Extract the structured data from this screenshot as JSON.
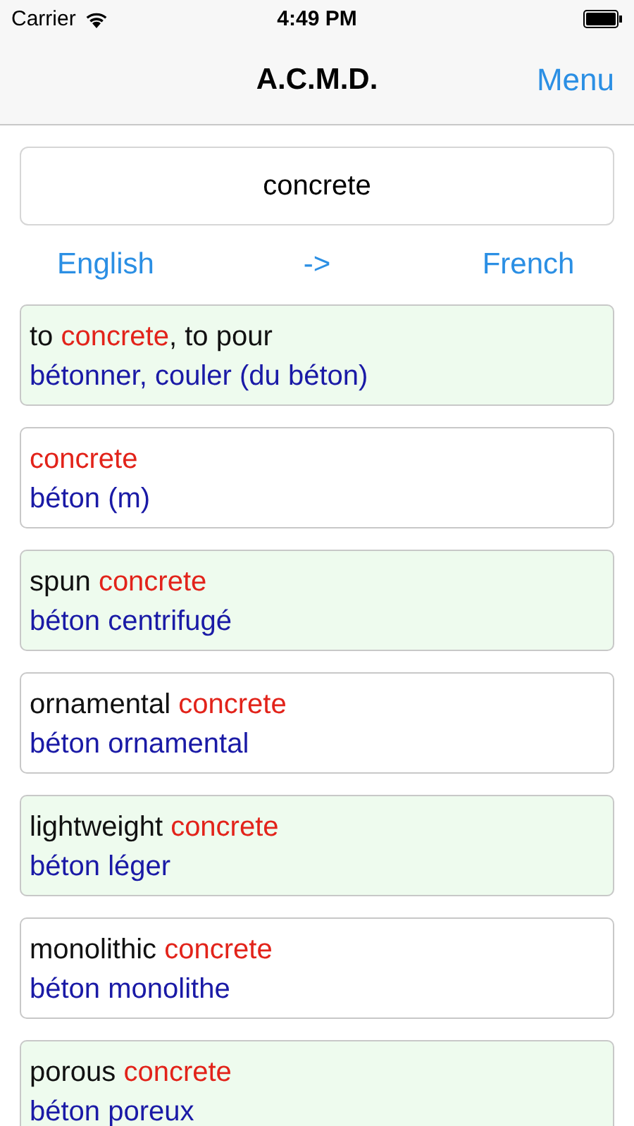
{
  "status_bar": {
    "carrier": "Carrier",
    "time": "4:49 PM"
  },
  "nav_bar": {
    "title": "A.C.M.D.",
    "menu": "Menu"
  },
  "search": {
    "value": "concrete"
  },
  "languages": {
    "from": "English",
    "arrow": "->",
    "to": "French"
  },
  "results": [
    {
      "shaded": true,
      "term": [
        {
          "text": "to ",
          "match": false
        },
        {
          "text": "concrete",
          "match": true
        },
        {
          "text": ", to pour",
          "match": false
        }
      ],
      "translation": "bétonner, couler (du béton)"
    },
    {
      "shaded": false,
      "term": [
        {
          "text": "concrete",
          "match": true
        }
      ],
      "translation": "béton (m)"
    },
    {
      "shaded": true,
      "term": [
        {
          "text": "spun ",
          "match": false
        },
        {
          "text": "concrete",
          "match": true
        }
      ],
      "translation": "béton centrifugé"
    },
    {
      "shaded": false,
      "term": [
        {
          "text": "ornamental ",
          "match": false
        },
        {
          "text": "concrete",
          "match": true
        }
      ],
      "translation": "béton ornamental"
    },
    {
      "shaded": true,
      "term": [
        {
          "text": "lightweight ",
          "match": false
        },
        {
          "text": "concrete",
          "match": true
        }
      ],
      "translation": "béton léger"
    },
    {
      "shaded": false,
      "term": [
        {
          "text": "monolithic ",
          "match": false
        },
        {
          "text": "concrete",
          "match": true
        }
      ],
      "translation": "béton monolithe"
    },
    {
      "shaded": true,
      "term": [
        {
          "text": "porous ",
          "match": false
        },
        {
          "text": "concrete",
          "match": true
        }
      ],
      "translation": "béton poreux"
    }
  ]
}
